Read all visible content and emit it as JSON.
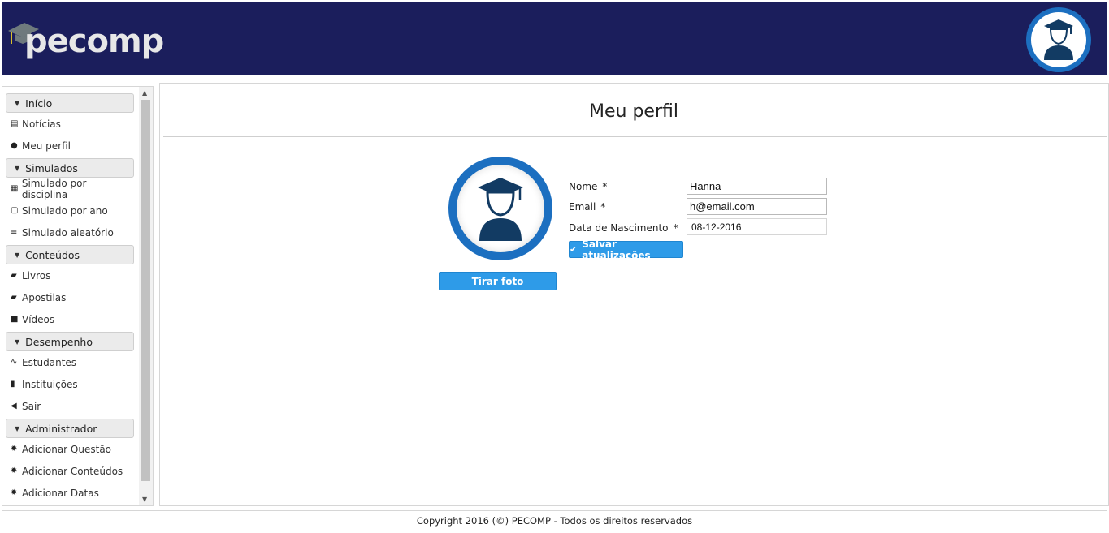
{
  "header": {
    "logo_text": "pecomp",
    "avatar_icon": "graduate-avatar-icon",
    "colors": {
      "background": "#1b1e5c",
      "accent": "#1c6fc0"
    }
  },
  "sidebar": {
    "sections": [
      {
        "title": "Início",
        "items": [
          {
            "label": "Notícias",
            "icon": "newspaper-icon"
          },
          {
            "label": "Meu perfil",
            "icon": "user-icon"
          }
        ]
      },
      {
        "title": "Simulados",
        "items": [
          {
            "label": "Simulado por disciplina",
            "icon": "table-icon"
          },
          {
            "label": "Simulado por ano",
            "icon": "calendar-icon"
          },
          {
            "label": "Simulado aleatório",
            "icon": "list-icon"
          }
        ]
      },
      {
        "title": "Conteúdos",
        "items": [
          {
            "label": "Livros",
            "icon": "book-icon"
          },
          {
            "label": "Apostilas",
            "icon": "book-icon"
          },
          {
            "label": "Vídeos",
            "icon": "video-camera-icon"
          }
        ]
      },
      {
        "title": "Desempenho",
        "items": [
          {
            "label": "Estudantes",
            "icon": "line-chart-icon"
          },
          {
            "label": "Instituições",
            "icon": "bar-chart-icon"
          },
          {
            "label": "Sair",
            "icon": "arrow-circle-left-icon"
          }
        ]
      },
      {
        "title": "Administrador",
        "items": [
          {
            "label": "Adicionar Questão",
            "icon": "gear-icon"
          },
          {
            "label": "Adicionar Conteúdos",
            "icon": "gear-icon"
          },
          {
            "label": "Adicionar Datas",
            "icon": "gear-icon"
          }
        ]
      }
    ]
  },
  "main": {
    "title": "Meu perfil",
    "photo_button": "Tirar foto",
    "form": {
      "name_label": "Nome",
      "name_value": "Hanna",
      "email_label": "Email",
      "email_value": "h@email.com",
      "birth_label": "Data de Nascimento",
      "birth_value": "08-12-2016",
      "required_mark": "*",
      "save_button": "Salvar atualizações"
    }
  },
  "footer": {
    "text": "Copyright 2016 (©) PECOMP - Todos os direitos reservados"
  }
}
